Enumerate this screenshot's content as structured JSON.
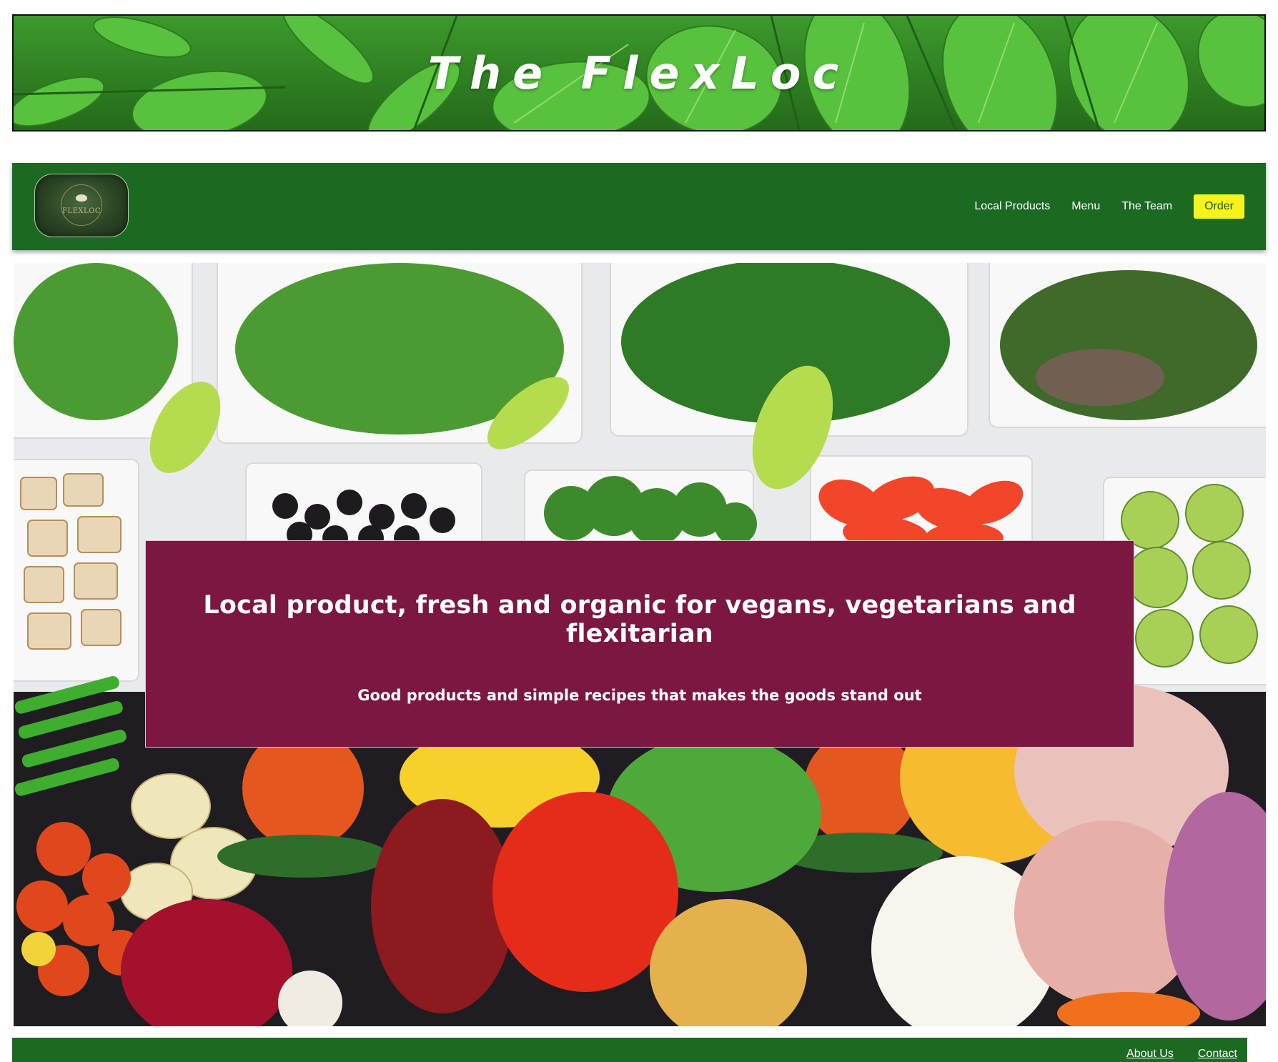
{
  "banner": {
    "title": "The FlexLoc"
  },
  "navbar": {
    "logo_text": "FLEXLOC",
    "links": [
      {
        "label": "Local Products"
      },
      {
        "label": "Menu"
      },
      {
        "label": "The Team"
      }
    ],
    "order_label": "Order"
  },
  "hero": {
    "heading": "Local product, fresh and organic for vegans, vegetarians and flexitarian",
    "subheading": "Good products and simple recipes that makes the goods stand out"
  },
  "footer": {
    "links": [
      {
        "label": "About Us"
      },
      {
        "label": "Contact"
      }
    ]
  },
  "colors": {
    "nav_green": "#1c6a22",
    "hero_box": "#7b1740",
    "order_button": "#f7f31a"
  }
}
